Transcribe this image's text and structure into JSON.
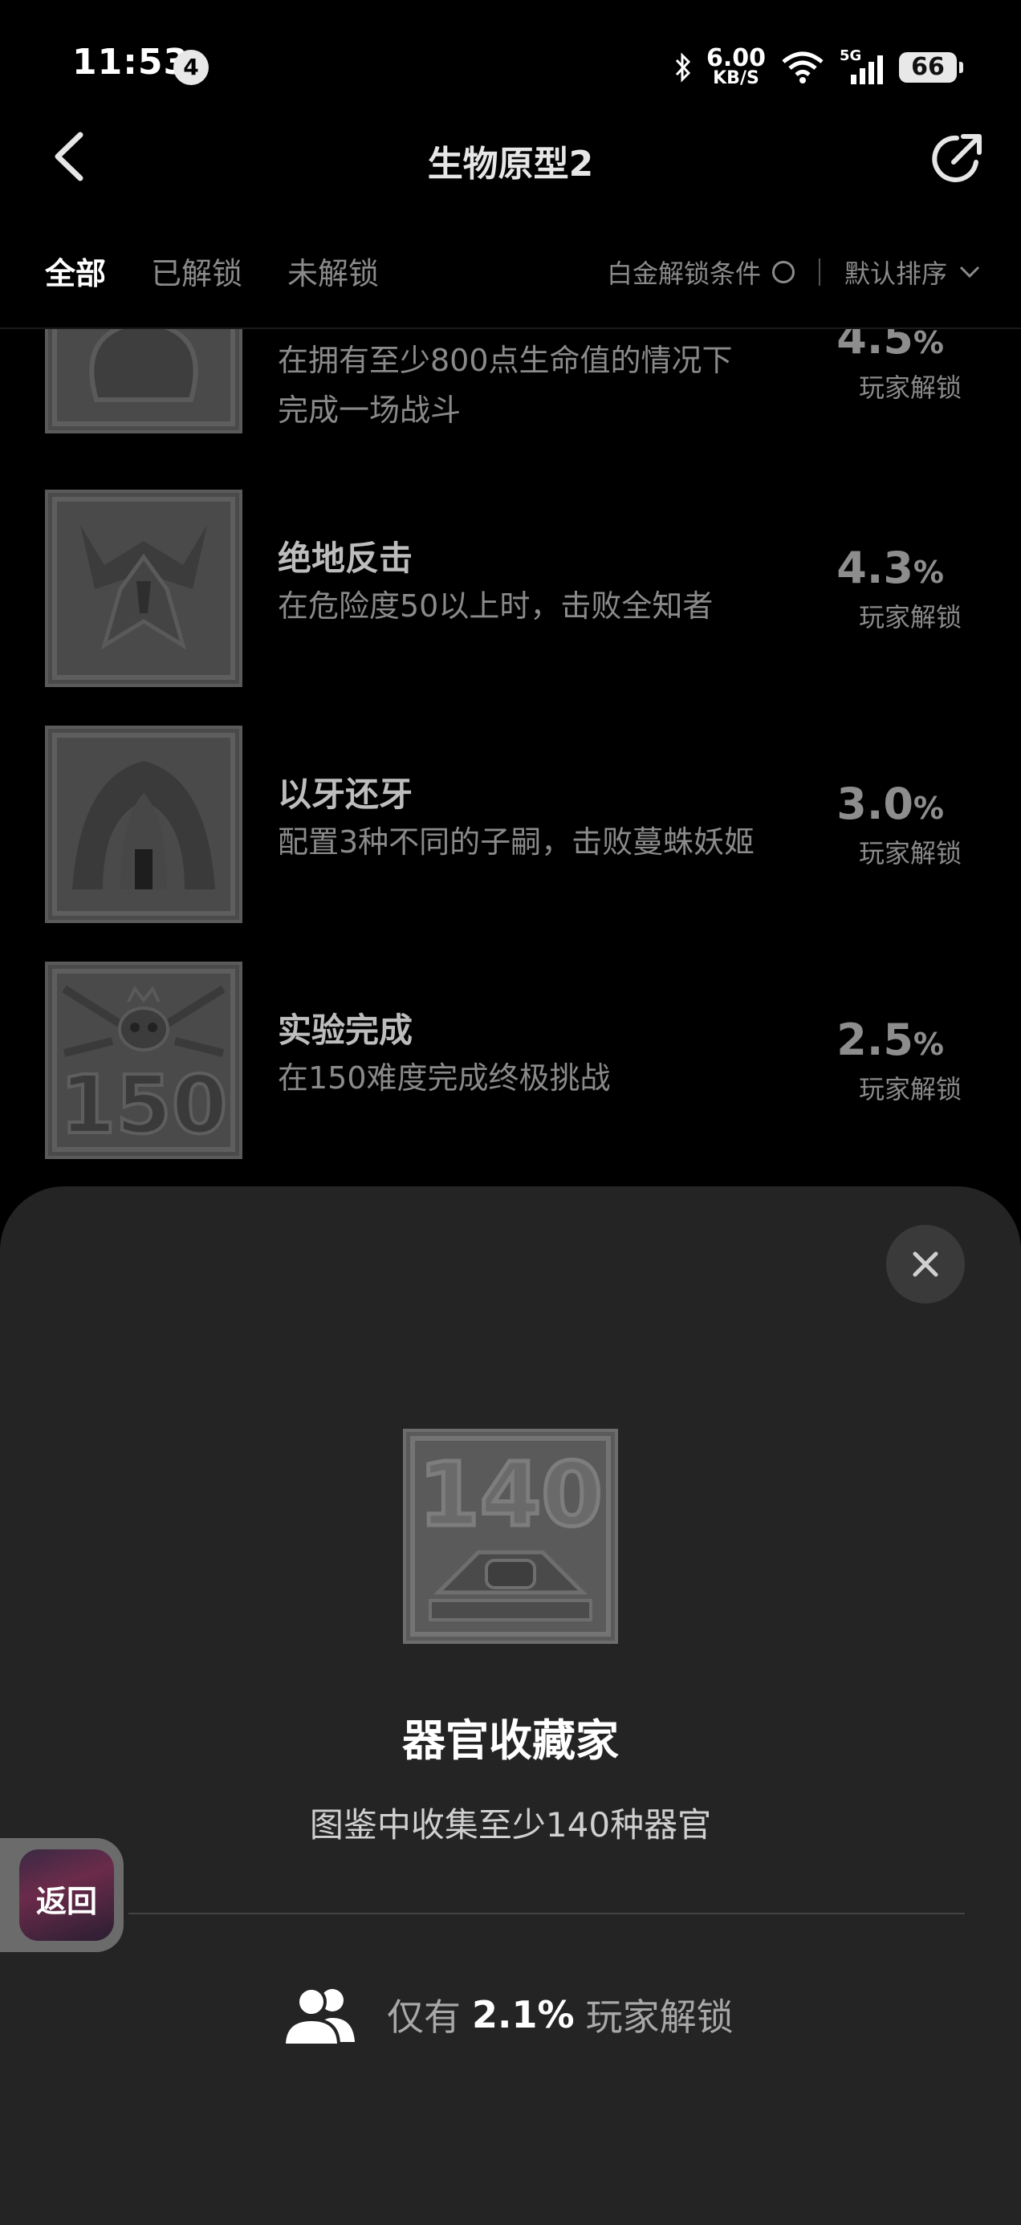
{
  "status_bar": {
    "time": "11:53",
    "notification_count": "4",
    "net_speed_value": "6.00",
    "net_speed_unit": "KB/S",
    "signal_label": "5G",
    "battery": "66"
  },
  "header": {
    "title": "生物原型2"
  },
  "tabs": [
    {
      "label": "全部",
      "active": true
    },
    {
      "label": "已解锁",
      "active": false
    },
    {
      "label": "未解锁",
      "active": false
    }
  ],
  "filters": {
    "platinum_condition": "白金解锁条件",
    "sort": "默认排序"
  },
  "achievements": [
    {
      "name": "",
      "desc": [
        "在拥有至少800点生命值的情况下",
        "完成一场战斗"
      ],
      "pct": "4.5",
      "pct_unit": "%",
      "pct_label": "玩家解锁"
    },
    {
      "name": "绝地反击",
      "desc": [
        "在危险度50以上时，击败全知者"
      ],
      "pct": "4.3",
      "pct_unit": "%",
      "pct_label": "玩家解锁"
    },
    {
      "name": "以牙还牙",
      "desc": [
        "配置3种不同的子嗣，击败蔓蛛妖姬"
      ],
      "pct": "3.0",
      "pct_unit": "%",
      "pct_label": "玩家解锁"
    },
    {
      "name": "实验完成",
      "desc": [
        "在150难度完成终极挑战"
      ],
      "pct": "2.5",
      "pct_unit": "%",
      "pct_label": "玩家解锁",
      "icon_text": "150"
    }
  ],
  "detail": {
    "icon_text": "140",
    "title": "器官收藏家",
    "desc": "图鉴中收集至少140种器官",
    "stat_prefix": "仅有",
    "stat_value": "2.1%",
    "stat_suffix": "玩家解锁"
  },
  "floating": {
    "return_label": "返回"
  }
}
